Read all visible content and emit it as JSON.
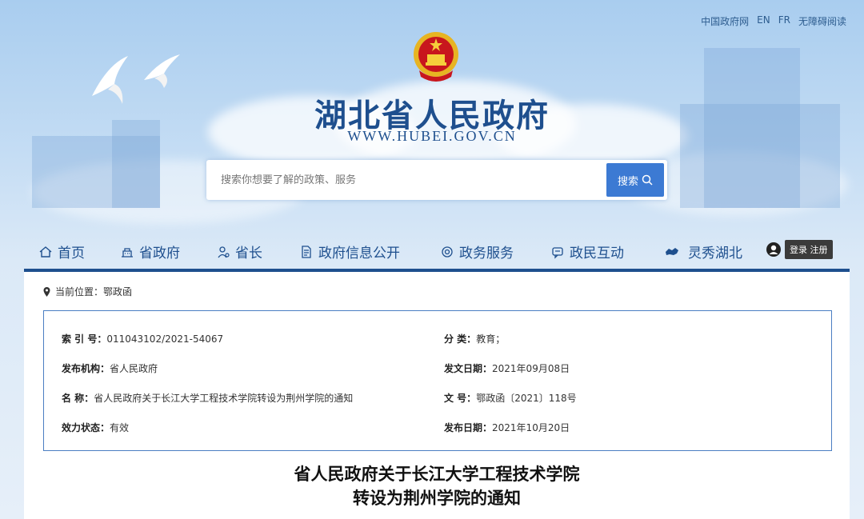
{
  "top_links": [
    "中国政府网",
    "EN",
    "FR",
    "无障碍阅读"
  ],
  "site": {
    "title": "湖北省人民政府",
    "url": "WWW.HUBEI.GOV.CN"
  },
  "search": {
    "placeholder": "搜索你想要了解的政策、服务",
    "button_label": "搜索"
  },
  "nav": {
    "items": [
      {
        "label": "首页",
        "icon": "home-icon"
      },
      {
        "label": "省政府",
        "icon": "building-icon"
      },
      {
        "label": "省长",
        "icon": "user-icon"
      },
      {
        "label": "政府信息公开",
        "icon": "document-icon"
      },
      {
        "label": "政务服务",
        "icon": "service-icon"
      },
      {
        "label": "政民互动",
        "icon": "chat-icon"
      },
      {
        "label": "灵秀湖北",
        "icon": "hubei-map-icon"
      }
    ],
    "login_label": "登录 注册"
  },
  "breadcrumb": {
    "prefix": "当前位置：",
    "current": "鄂政函"
  },
  "meta": {
    "index_no_label": "索 引 号：",
    "index_no": "011043102/2021-54067",
    "category_label": "分 类：",
    "category": "教育；",
    "issuer_label": "发布机构：",
    "issuer": "省人民政府",
    "doc_date_label": "发文日期：",
    "doc_date": "2021年09月08日",
    "name_label": "名 称：",
    "name": "省人民政府关于长江大学工程技术学院转设为荆州学院的通知",
    "doc_no_label": "文 号：",
    "doc_no": "鄂政函〔2021〕118号",
    "status_label": "效力状态：",
    "status": "有效",
    "publish_date_label": "发布日期：",
    "publish_date": "2021年10月20日"
  },
  "document": {
    "title_line1": "省人民政府关于长江大学工程技术学院",
    "title_line2": "转设为荆州学院的通知"
  },
  "colors": {
    "brand_blue": "#1e4f8e",
    "search_button": "#3c7ad3",
    "box_border": "#4a7ec2"
  }
}
